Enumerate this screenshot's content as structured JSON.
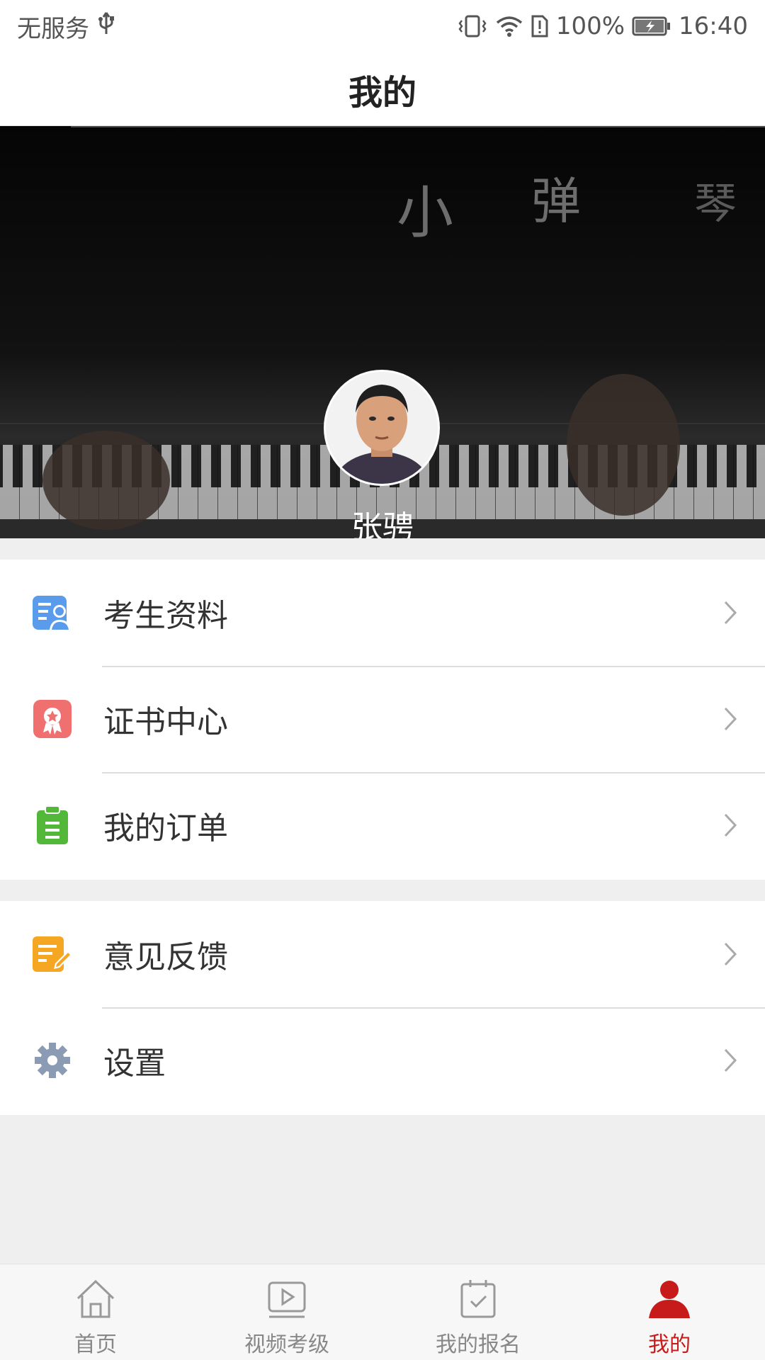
{
  "status_bar": {
    "carrier": "无服务",
    "battery_percent": "100%",
    "time": "16:40",
    "icons": [
      "usb-icon",
      "vibrate-icon",
      "wifi-icon",
      "sim-alert-icon",
      "battery-charging-icon"
    ]
  },
  "header": {
    "title": "我的"
  },
  "profile": {
    "name": "张骋",
    "banner_watermark": [
      "小",
      "弹",
      "琴"
    ]
  },
  "menu": {
    "group1": [
      {
        "label": "考生资料",
        "icon": "student-profile-icon",
        "color": "#4a90e2"
      },
      {
        "label": "证书中心",
        "icon": "certificate-icon",
        "color": "#f06b6b"
      },
      {
        "label": "我的订单",
        "icon": "order-clipboard-icon",
        "color": "#53b73a"
      }
    ],
    "group2": [
      {
        "label": "意见反馈",
        "icon": "feedback-edit-icon",
        "color": "#f5a623"
      },
      {
        "label": "设置",
        "icon": "gear-icon",
        "color": "#8a9bb3"
      }
    ]
  },
  "tabbar": {
    "tabs": [
      {
        "label": "首页",
        "icon": "home-icon",
        "active": false
      },
      {
        "label": "视频考级",
        "icon": "video-play-icon",
        "active": false
      },
      {
        "label": "我的报名",
        "icon": "calendar-check-icon",
        "active": false
      },
      {
        "label": "我的",
        "icon": "user-icon",
        "active": true
      }
    ],
    "active_color": "#c71b1b",
    "inactive_color": "#888888"
  }
}
